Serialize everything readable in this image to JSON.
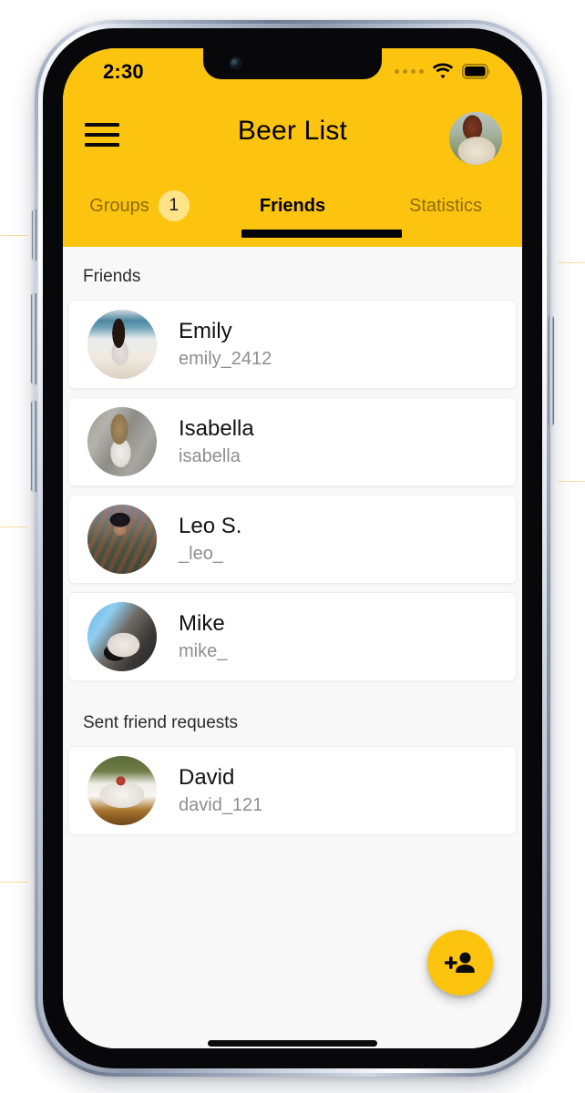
{
  "status_bar": {
    "time": "2:30",
    "cellular_icon": "cellular-dots-icon",
    "wifi_icon": "wifi-icon",
    "battery_icon": "battery-full-icon",
    "cellular_dots": 4
  },
  "header": {
    "menu_icon": "hamburger-menu-icon",
    "title": "Beer List",
    "avatar_name": "user-avatar",
    "background_color": "#fdc40f"
  },
  "tabs": [
    {
      "label": "Groups",
      "badge": "1",
      "active": false
    },
    {
      "label": "Friends",
      "badge": null,
      "active": true
    },
    {
      "label": "Statistics",
      "badge": null,
      "active": false
    }
  ],
  "sections": [
    {
      "title": "Friends",
      "items": [
        {
          "name": "Emily",
          "handle": "emily_2412",
          "avatar": "avatar-emily"
        },
        {
          "name": "Isabella",
          "handle": "isabella",
          "avatar": "avatar-isabella"
        },
        {
          "name": "Leo S.",
          "handle": "_leo_",
          "avatar": "avatar-leo"
        },
        {
          "name": "Mike",
          "handle": "mike_",
          "avatar": "avatar-mike"
        }
      ]
    },
    {
      "title": "Sent friend requests",
      "items": [
        {
          "name": "David",
          "handle": "david_121",
          "avatar": "avatar-david"
        }
      ]
    }
  ],
  "fab": {
    "icon": "person-add-icon",
    "label": "Add friend",
    "color": "#fdc40f"
  },
  "home_indicator": "home-indicator",
  "colors": {
    "accent": "#fdc40f",
    "badge": "#ffe389",
    "list_background": "#f8f8f8",
    "card_background": "#ffffff",
    "primary_text": "#121212",
    "secondary_text": "#8e8e8e"
  }
}
